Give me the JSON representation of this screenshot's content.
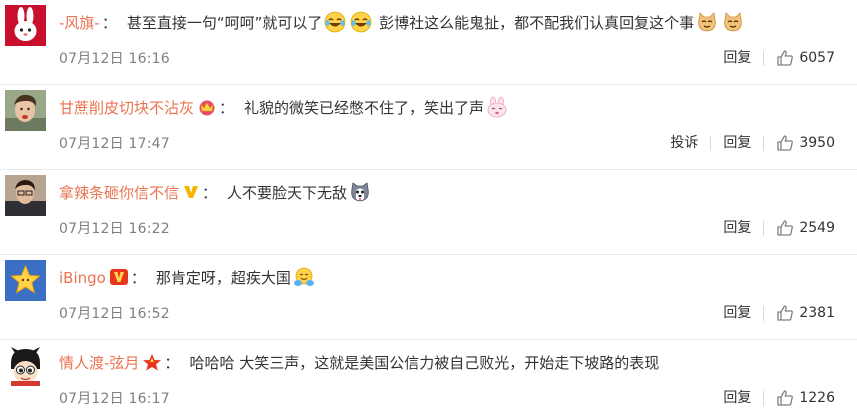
{
  "comments": [
    {
      "username": "-风旗-",
      "colon": "：",
      "text_parts": [
        "甚至直接一句“呵呵”就可以了",
        "彭博社这么能鬼扯，都不配我们认真回复这个事"
      ],
      "time": "07月12日 16:16",
      "reply_label": "回复",
      "likes": "6057"
    },
    {
      "username": "甘蔗削皮切块不沾灰",
      "colon": "：",
      "text_parts": [
        "礼貌的微笑已经憋不住了，笑出了声"
      ],
      "time": "07月12日 17:47",
      "report_label": "投诉",
      "reply_label": "回复",
      "likes": "3950"
    },
    {
      "username": "拿辣条砸你信不信",
      "colon": "：",
      "text_parts": [
        "人不要脸天下无敌"
      ],
      "time": "07月12日 16:22",
      "reply_label": "回复",
      "likes": "2549"
    },
    {
      "username": "iBingo",
      "colon": "：",
      "text_parts": [
        "那肯定呀，超疾大国"
      ],
      "time": "07月12日 16:52",
      "reply_label": "回复",
      "likes": "2381"
    },
    {
      "username": "情人渡-弦月",
      "colon": "：",
      "text_parts": [
        "哈哈哈 大笑三声，这就是美国公信力被自己败光，开始走下坡路的表现"
      ],
      "time": "07月12日 16:17",
      "reply_label": "回复",
      "likes": "1226"
    }
  ],
  "colors": {
    "username": "#eb7350",
    "text": "#333333",
    "time": "#808080",
    "divider": "#ebebeb"
  },
  "icons": {
    "like": "thumbs-up-icon",
    "emoji_laugh_cry": "laugh-cry-emoji",
    "emoji_cat": "cat-emoji",
    "emoji_bunny": "bunny-emoji",
    "emoji_husky": "husky-emoji",
    "emoji_hug": "hug-emoji"
  }
}
